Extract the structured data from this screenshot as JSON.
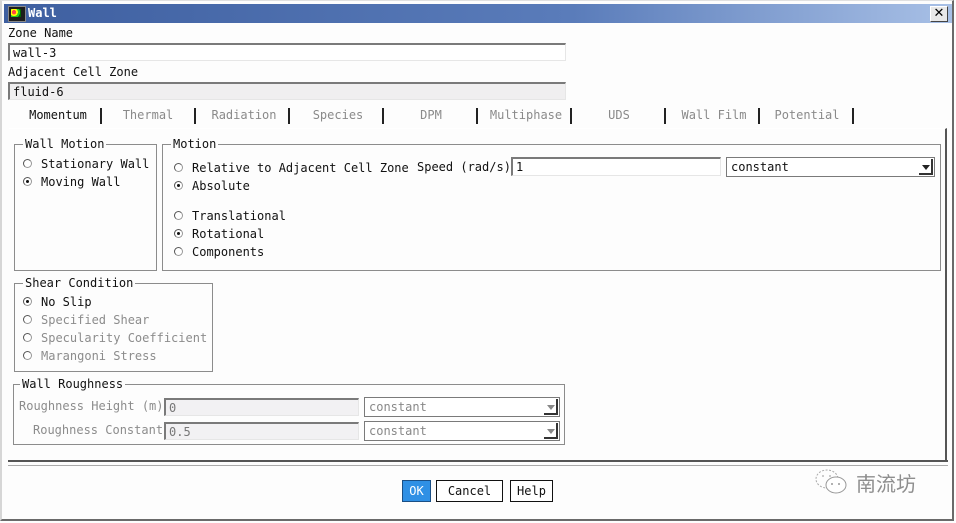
{
  "window": {
    "title": "Wall",
    "close_label": "✕"
  },
  "zone_name": {
    "label": "Zone Name",
    "value": "wall-3"
  },
  "adjacent_cell_zone": {
    "label": "Adjacent Cell Zone",
    "value": "fluid-6"
  },
  "tabs": [
    {
      "label": "Momentum",
      "active": true
    },
    {
      "label": "Thermal",
      "active": false
    },
    {
      "label": "Radiation",
      "active": false
    },
    {
      "label": "Species",
      "active": false
    },
    {
      "label": "DPM",
      "active": false
    },
    {
      "label": "Multiphase",
      "active": false
    },
    {
      "label": "UDS",
      "active": false
    },
    {
      "label": "Wall Film",
      "active": false
    },
    {
      "label": "Potential",
      "active": false
    }
  ],
  "wall_motion": {
    "title": "Wall Motion",
    "options": [
      {
        "label": "Stationary Wall",
        "selected": false
      },
      {
        "label": "Moving Wall",
        "selected": true
      }
    ]
  },
  "motion": {
    "title": "Motion",
    "reference_options": [
      {
        "label": "Relative to Adjacent Cell Zone",
        "selected": false
      },
      {
        "label": "Absolute",
        "selected": true
      }
    ],
    "type_options": [
      {
        "label": "Translational",
        "selected": false
      },
      {
        "label": "Rotational",
        "selected": true
      },
      {
        "label": "Components",
        "selected": false
      }
    ],
    "speed_label": "Speed (rad/s)",
    "speed_value": "1",
    "speed_method": "constant"
  },
  "shear_condition": {
    "title": "Shear Condition",
    "options": [
      {
        "label": "No Slip",
        "selected": true,
        "enabled": true
      },
      {
        "label": "Specified Shear",
        "selected": false,
        "enabled": false
      },
      {
        "label": "Specularity Coefficient",
        "selected": false,
        "enabled": false
      },
      {
        "label": "Marangoni Stress",
        "selected": false,
        "enabled": false
      }
    ]
  },
  "wall_roughness": {
    "title": "Wall Roughness",
    "height_label": "Roughness Height (m)",
    "height_value": "0",
    "height_method": "constant",
    "constant_label": "Roughness Constant",
    "constant_value": "0.5",
    "constant_method": "constant"
  },
  "buttons": {
    "ok": "OK",
    "cancel": "Cancel",
    "help": "Help"
  },
  "watermark": {
    "text": "南流坊"
  },
  "colors": {
    "titlebar_start": "#3e5fa0",
    "ok_button": "#2f90e5"
  }
}
